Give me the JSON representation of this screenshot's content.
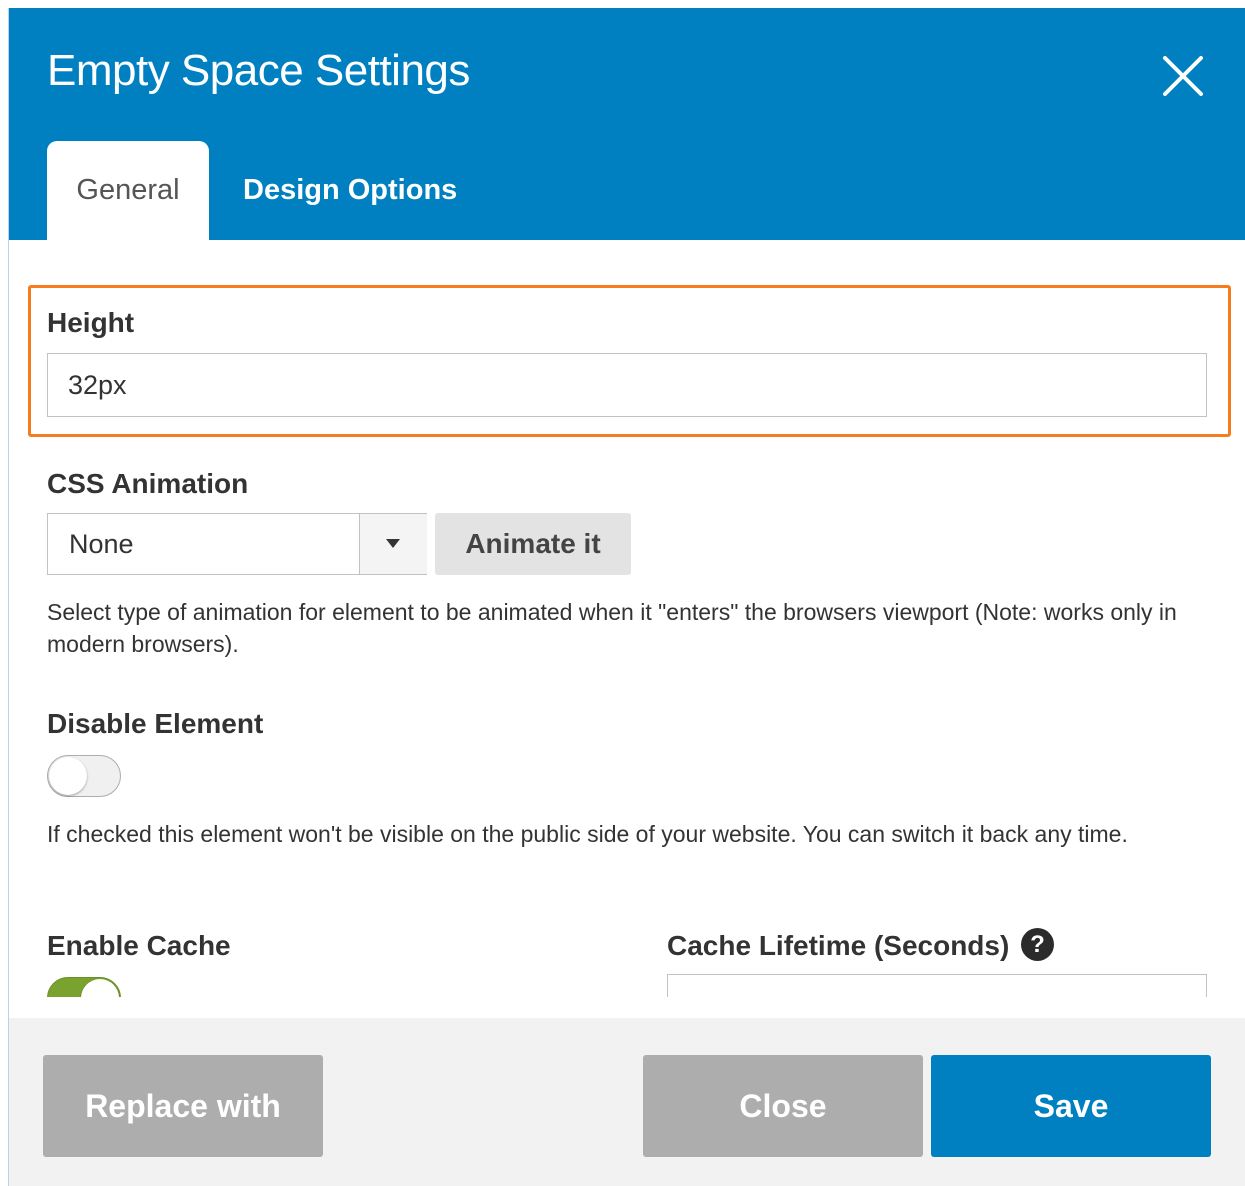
{
  "dialog": {
    "title": "Empty Space Settings"
  },
  "tabs": [
    {
      "label": "General",
      "active": true
    },
    {
      "label": "Design Options",
      "active": false
    }
  ],
  "fields": {
    "height": {
      "label": "Height",
      "value": "32px"
    },
    "css_animation": {
      "label": "CSS Animation",
      "selected": "None",
      "animate_button": "Animate it",
      "help": "Select type of animation for element to be animated when it \"enters\" the browsers viewport (Note: works only in modern browsers)."
    },
    "disable_element": {
      "label": "Disable Element",
      "checked": false,
      "help": "If checked this element won't be visible on the public side of your website. You can switch it back any time."
    },
    "enable_cache": {
      "label": "Enable Cache",
      "checked": true
    },
    "cache_lifetime": {
      "label": "Cache Lifetime (Seconds)",
      "help_icon": "?"
    }
  },
  "footer": {
    "replace_label": "Replace with",
    "close_label": "Close",
    "save_label": "Save"
  },
  "colors": {
    "accent": "#0080c0",
    "highlight": "#f57c1f",
    "toggle_on": "#79a22e",
    "disabled_button": "#adadad"
  }
}
